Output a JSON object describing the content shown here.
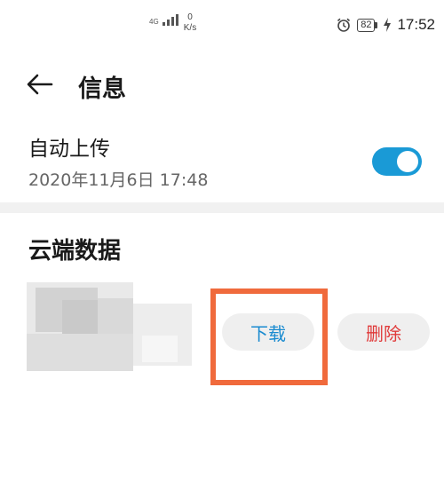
{
  "status_bar": {
    "network_label": "4G",
    "speed_value": "0",
    "speed_unit": "K/s",
    "battery": "82",
    "time": "17:52",
    "icons": [
      "signal-icon",
      "alarm-icon",
      "battery-icon",
      "charging-icon"
    ]
  },
  "header": {
    "back_icon": "arrow-left-icon",
    "title": "信息"
  },
  "auto_upload": {
    "title": "自动上传",
    "timestamp": "2020年11月6日 17:48",
    "enabled": true
  },
  "cloud_data": {
    "title": "云端数据",
    "download_label": "下载",
    "delete_label": "删除"
  },
  "colors": {
    "accent": "#1a9ad6",
    "download_text": "#1a8bd0",
    "delete_text": "#e03a3a",
    "highlight": "#f06a3c"
  }
}
